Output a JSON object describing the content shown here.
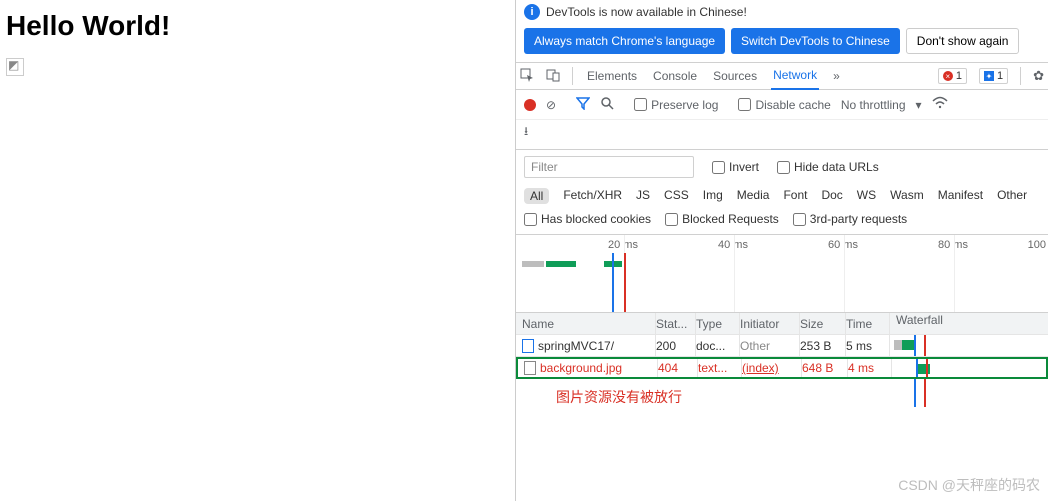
{
  "page": {
    "heading": "Hello World!"
  },
  "infobar": {
    "msg": "DevTools is now available in Chinese!"
  },
  "lang": {
    "match": "Always match Chrome's language",
    "switch": "Switch DevTools to Chinese",
    "dismiss": "Don't show again"
  },
  "tabs": {
    "elements": "Elements",
    "console": "Console",
    "sources": "Sources",
    "network": "Network",
    "more": "»"
  },
  "badges": {
    "err": "1",
    "info": "1"
  },
  "toolbar": {
    "preserve": "Preserve log",
    "disable": "Disable cache",
    "throttle": "No throttling"
  },
  "filter": {
    "placeholder": "Filter",
    "invert": "Invert",
    "hide": "Hide data URLs"
  },
  "types": {
    "all": "All",
    "fetch": "Fetch/XHR",
    "js": "JS",
    "css": "CSS",
    "img": "Img",
    "media": "Media",
    "font": "Font",
    "doc": "Doc",
    "ws": "WS",
    "wasm": "Wasm",
    "manifest": "Manifest",
    "other": "Other"
  },
  "extra": {
    "blocked_cookies": "Has blocked cookies",
    "blocked_req": "Blocked Requests",
    "third": "3rd-party requests"
  },
  "timeline": {
    "t20": "20 ms",
    "t40": "40 ms",
    "t60": "60 ms",
    "t80": "80 ms",
    "t100": "100"
  },
  "headers": {
    "name": "Name",
    "status": "Stat...",
    "type": "Type",
    "initiator": "Initiator",
    "size": "Size",
    "time": "Time",
    "waterfall": "Waterfall"
  },
  "rows": [
    {
      "name": "springMVC17/",
      "status": "200",
      "type": "doc...",
      "initiator": "Other",
      "size": "253 B",
      "time": "5 ms",
      "err": false
    },
    {
      "name": "background.jpg",
      "status": "404",
      "type": "text...",
      "initiator": "(index)",
      "size": "648 B",
      "time": "4 ms",
      "err": true
    }
  ],
  "annotation": "图片资源没有被放行",
  "watermark": "CSDN @天秤座的码农"
}
